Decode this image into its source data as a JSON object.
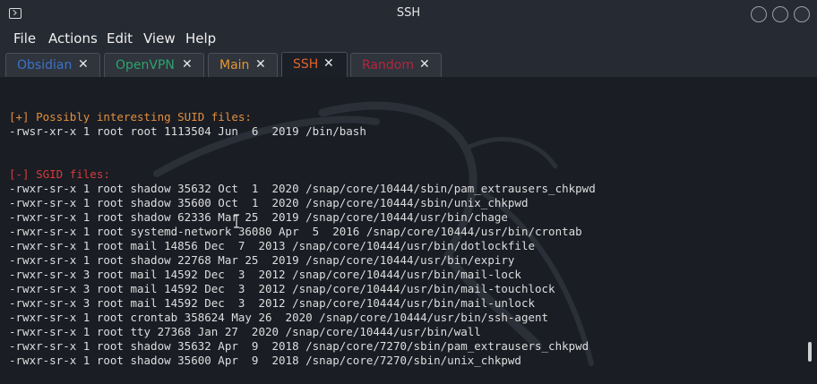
{
  "window": {
    "title": "SSH"
  },
  "menu": [
    "File",
    "Actions",
    "Edit",
    "View",
    "Help"
  ],
  "tabs": [
    {
      "label": "Obsidian",
      "color": "#3b73c9"
    },
    {
      "label": "OpenVPN",
      "color": "#2fa36b"
    },
    {
      "label": "Main",
      "color": "#e6972c"
    },
    {
      "label": "SSH",
      "color": "#e0632a"
    },
    {
      "label": "Random",
      "color": "#b8243b"
    }
  ],
  "active_tab": "SSH",
  "close_glyph": "✕",
  "terminal": {
    "suid_header": "[+] Possibly interesting SUID files:",
    "suid_files": [
      "-rwsr-xr-x 1 root root 1113504 Jun  6  2019 /bin/bash"
    ],
    "sgid_header": "[-] SGID files:",
    "sgid_files": [
      "-rwxr-sr-x 1 root shadow 35632 Oct  1  2020 /snap/core/10444/sbin/pam_extrausers_chkpwd",
      "-rwxr-sr-x 1 root shadow 35600 Oct  1  2020 /snap/core/10444/sbin/unix_chkpwd",
      "-rwxr-sr-x 1 root shadow 62336 Mar 25  2019 /snap/core/10444/usr/bin/chage",
      "-rwxr-sr-x 1 root systemd-network 36080 Apr  5  2016 /snap/core/10444/usr/bin/crontab",
      "-rwxr-sr-x 1 root mail 14856 Dec  7  2013 /snap/core/10444/usr/bin/dotlockfile",
      "-rwxr-sr-x 1 root shadow 22768 Mar 25  2019 /snap/core/10444/usr/bin/expiry",
      "-rwxr-sr-x 3 root mail 14592 Dec  3  2012 /snap/core/10444/usr/bin/mail-lock",
      "-rwxr-sr-x 3 root mail 14592 Dec  3  2012 /snap/core/10444/usr/bin/mail-touchlock",
      "-rwxr-sr-x 3 root mail 14592 Dec  3  2012 /snap/core/10444/usr/bin/mail-unlock",
      "-rwxr-sr-x 1 root crontab 358624 May 26  2020 /snap/core/10444/usr/bin/ssh-agent",
      "-rwxr-sr-x 1 root tty 27368 Jan 27  2020 /snap/core/10444/usr/bin/wall",
      "-rwxr-sr-x 1 root shadow 35632 Apr  9  2018 /snap/core/7270/sbin/pam_extrausers_chkpwd",
      "-rwxr-sr-x 1 root shadow 35600 Apr  9  2018 /snap/core/7270/sbin/unix_chkpwd"
    ]
  },
  "colors": {
    "background": "#1a1d24",
    "chrome": "#262a33",
    "header_orange": "#e38f3d",
    "header_red": "#d63b3b",
    "text": "#dedede"
  }
}
